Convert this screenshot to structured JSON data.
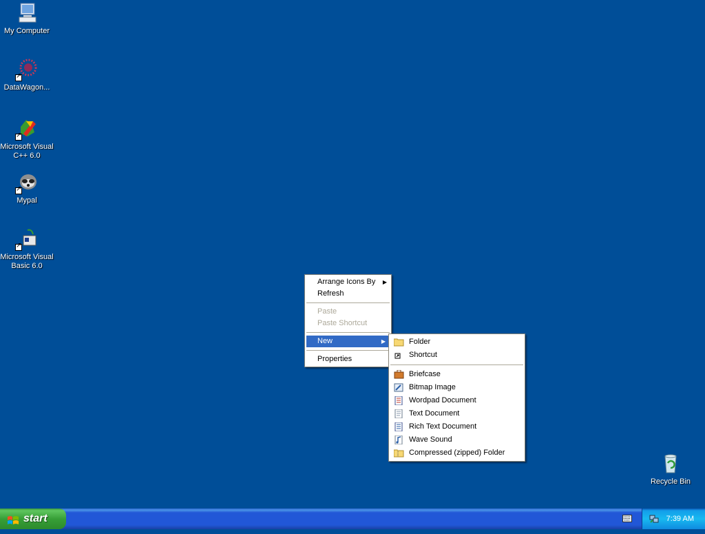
{
  "desktop": {
    "icons": [
      {
        "label": "My Computer",
        "icon": "computer-icon"
      },
      {
        "label": "DataWagon...",
        "icon": "datawagon-icon"
      },
      {
        "label": "Microsoft Visual C++ 6.0",
        "icon": "visual-cpp-icon"
      },
      {
        "label": "Mypal",
        "icon": "mypal-icon"
      },
      {
        "label": "Microsoft Visual Basic 6.0",
        "icon": "visual-basic-icon"
      },
      {
        "label": "Recycle Bin",
        "icon": "recycle-bin-icon"
      }
    ]
  },
  "context_menu": {
    "items": [
      {
        "label": "Arrange Icons By",
        "has_submenu": true,
        "state": "normal"
      },
      {
        "label": "Refresh",
        "state": "normal"
      },
      {
        "label": "Paste",
        "state": "disabled"
      },
      {
        "label": "Paste Shortcut",
        "state": "disabled"
      },
      {
        "label": "New",
        "has_submenu": true,
        "state": "selected"
      },
      {
        "label": "Properties",
        "state": "normal"
      }
    ]
  },
  "new_submenu": {
    "items": [
      {
        "label": "Folder",
        "icon": "folder-icon"
      },
      {
        "label": "Shortcut",
        "icon": "shortcut-icon"
      },
      {
        "label": "Briefcase",
        "icon": "briefcase-icon"
      },
      {
        "label": "Bitmap Image",
        "icon": "bitmap-icon"
      },
      {
        "label": "Wordpad Document",
        "icon": "wordpad-icon"
      },
      {
        "label": "Text Document",
        "icon": "text-document-icon"
      },
      {
        "label": "Rich Text Document",
        "icon": "rich-text-icon"
      },
      {
        "label": "Wave Sound",
        "icon": "wave-sound-icon"
      },
      {
        "label": "Compressed (zipped) Folder",
        "icon": "zip-folder-icon"
      }
    ]
  },
  "taskbar": {
    "start_label": "start",
    "clock": "7:39 AM"
  },
  "colors": {
    "desktop": "#004e98",
    "menu_highlight": "#316ac5",
    "start_green": "#379f37",
    "taskbar_blue": "#2157d7"
  }
}
